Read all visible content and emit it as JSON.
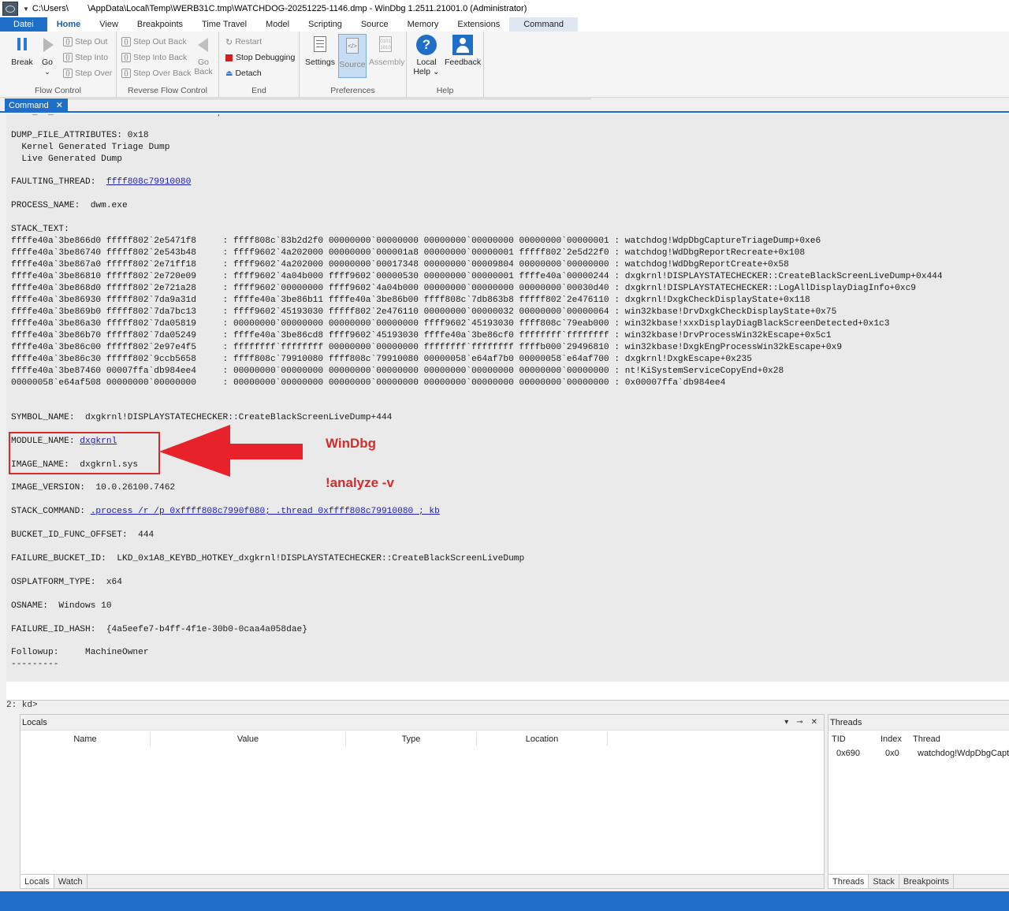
{
  "window": {
    "title": "C:\\Users\\        \\AppData\\Local\\Temp\\WERB31C.tmp\\WATCHDOG-20251225-1146.dmp - WinDbg 1.2511.21001.0 (Administrator)"
  },
  "menu": {
    "tabs": [
      "Datei",
      "Home",
      "View",
      "Breakpoints",
      "Time Travel",
      "Model",
      "Scripting",
      "Source",
      "Memory",
      "Extensions"
    ],
    "context_tab": "Command"
  },
  "ribbon": {
    "flow_control": {
      "label": "Flow Control",
      "break": "Break",
      "go": "Go",
      "step_out": "Step Out",
      "step_into": "Step Into",
      "step_over": "Step Over"
    },
    "reverse_flow": {
      "label": "Reverse Flow Control",
      "step_out_back": "Step Out Back",
      "step_into_back": "Step Into Back",
      "step_over_back": "Step Over Back",
      "go_back_1": "Go",
      "go_back_2": "Back"
    },
    "end": {
      "label": "End",
      "restart": "Restart",
      "stop": "Stop Debugging",
      "detach": "Detach"
    },
    "preferences": {
      "label": "Preferences",
      "settings": "Settings",
      "source": "Source",
      "assembly": "Assembly"
    },
    "help": {
      "label": "Help",
      "local_help_1": "Local",
      "local_help_2": "Help",
      "feedback": "Feedback"
    }
  },
  "command_tab": {
    "label": "Command"
  },
  "output": {
    "dump_attr": "DUMP_FILE_ATTRIBUTES: 0x18",
    "dump_attr_1": "  Kernel Generated Triage Dump",
    "dump_attr_2": "  Live Generated Dump",
    "faulting_thread_label": "FAULTING_THREAD:  ",
    "faulting_thread_value": "ffff808c79910080",
    "process_name": "PROCESS_NAME:  dwm.exe",
    "stack_text_label": "STACK_TEXT:",
    "stack": [
      "ffffe40a`3be866d0 fffff802`2e5471f8     : ffff808c`83b2d2f0 00000000`00000000 00000000`00000000 00000000`00000001 : watchdog!WdpDbgCaptureTriageDump+0xe6",
      "ffffe40a`3be86740 fffff802`2e543b48     : ffff9602`4a202000 00000000`000001a8 00000000`00000001 fffff802`2e5d22f0 : watchdog!WdDbgReportRecreate+0x108",
      "ffffe40a`3be867a0 fffff802`2e71ff18     : ffff9602`4a202000 00000000`00017348 00000000`00009804 00000000`00000000 : watchdog!WdDbgReportCreate+0x58",
      "ffffe40a`3be86810 fffff802`2e720e09     : ffff9602`4a04b000 ffff9602`00000530 00000000`00000001 ffffe40a`00000244 : dxgkrnl!DISPLAYSTATECHECKER::CreateBlackScreenLiveDump+0x444",
      "ffffe40a`3be868d0 fffff802`2e721a28     : ffff9602`00000000 ffff9602`4a04b000 00000000`00000000 00000000`00030d40 : dxgkrnl!DISPLAYSTATECHECKER::LogAllDisplayDiagInfo+0xc9",
      "ffffe40a`3be86930 fffff802`7da9a31d     : ffffe40a`3be86b11 ffffe40a`3be86b00 ffff808c`7db863b8 fffff802`2e476110 : dxgkrnl!DxgkCheckDisplayState+0x118",
      "ffffe40a`3be869b0 fffff802`7da7bc13     : ffff9602`45193030 fffff802`2e476110 00000000`00000032 00000000`00000064 : win32kbase!DrvDxgkCheckDisplayState+0x75",
      "ffffe40a`3be86a30 fffff802`7da05819     : 00000000`00000000 00000000`00000000 ffff9602`45193030 ffff808c`79eab000 : win32kbase!xxxDisplayDiagBlackScreenDetected+0x1c3",
      "ffffe40a`3be86b70 fffff802`7da05249     : ffffe40a`3be86cd8 ffff9602`45193030 ffffe40a`3be86cf0 ffffffff`ffffffff : win32kbase!DrvProcessWin32kEscape+0x5c1",
      "ffffe40a`3be86c00 fffff802`2e97e4f5     : ffffffff`ffffffff 00000000`00000000 ffffffff`ffffffff ffffb000`29496810 : win32kbase!DxgkEngProcessWin32kEscape+0x9",
      "ffffe40a`3be86c30 fffff802`9ccb5658     : ffff808c`79910080 ffff808c`79910080 00000058`e64af7b0 00000058`e64af700 : dxgkrnl!DxgkEscape+0x235",
      "ffffe40a`3be87460 00007ffa`db984ee4     : 00000000`00000000 00000000`00000000 00000000`00000000 00000000`00000000 : nt!KiSystemServiceCopyEnd+0x28",
      "00000058`e64af508 00000000`00000000     : 00000000`00000000 00000000`00000000 00000000`00000000 00000000`00000000 : 0x00007ffa`db984ee4"
    ],
    "symbol_name": "SYMBOL_NAME:  dxgkrnl!DISPLAYSTATECHECKER::CreateBlackScreenLiveDump+444",
    "module_name_label": "MODULE_NAME: ",
    "module_name_value": "dxgkrnl",
    "image_name": "IMAGE_NAME:  dxgkrnl.sys",
    "image_version": "IMAGE_VERSION:  10.0.26100.7462",
    "stack_command_label": "STACK_COMMAND: ",
    "stack_command_value": ".process /r /p 0xffff808c7990f080; .thread 0xffff808c79910080 ; kb",
    "bucket_offset": "BUCKET_ID_FUNC_OFFSET:  444",
    "failure_bucket": "FAILURE_BUCKET_ID:  LKD_0x1A8_KEYBD_HOTKEY_dxgkrnl!DISPLAYSTATECHECKER::CreateBlackScreenLiveDump",
    "osplatform": "OSPLATFORM_TYPE:  x64",
    "osname": "OSNAME:  Windows 10",
    "failure_hash": "FAILURE_ID_HASH:  {4a5eefe7-b4ff-4f1e-30b0-0caa4a058dae}",
    "followup": "Followup:     MachineOwner",
    "dashes": "---------"
  },
  "annotation": {
    "line1": "WinDbg",
    "line2": "!analyze -v",
    "color": "#d52b2b"
  },
  "prompt": {
    "text": "2: kd>"
  },
  "locals": {
    "title": "Locals",
    "columns": [
      "Name",
      "Value",
      "Type",
      "Location"
    ],
    "tabs": [
      "Locals",
      "Watch"
    ]
  },
  "threads": {
    "title": "Threads",
    "columns": [
      "TID",
      "Index",
      "Thread"
    ],
    "row": {
      "tid": "0x690",
      "index": "0x0",
      "thread": "watchdog!WdpDbgCapt"
    },
    "tabs": [
      "Threads",
      "Stack",
      "Breakpoints"
    ]
  },
  "colors": {
    "accent": "#1f6fc8",
    "link": "#1b1bb8"
  }
}
